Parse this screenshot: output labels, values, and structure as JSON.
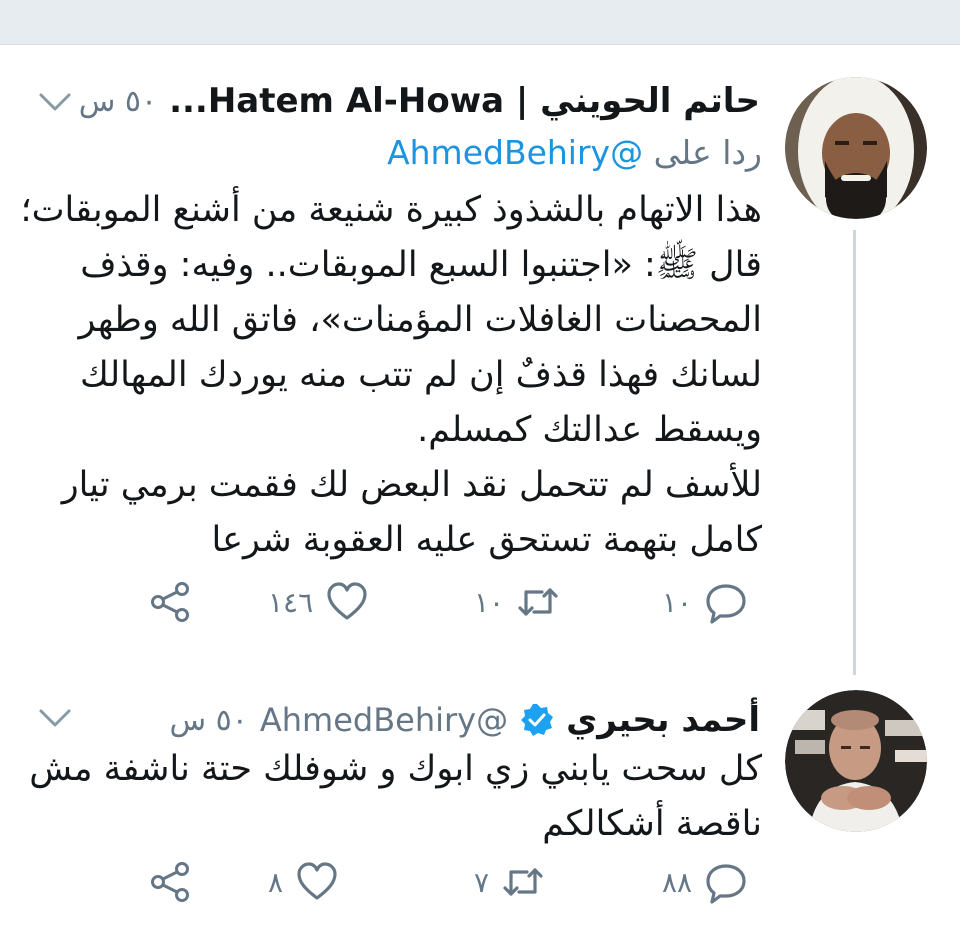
{
  "tweets": [
    {
      "display_name": "حاتم الحويني | Hatem Al-Howa...",
      "time": "٥٠ س",
      "replying_prefix": "ردا على",
      "replying_handle": "@AhmedBehiry",
      "lines": [
        "هذا الاتهام بالشذوذ كبيرة شنيعة من أشنع الموبقات؛",
        "قال ﷺ: «اجتنبوا السبع الموبقات.. وفيه: وقذف",
        "المحصنات الغافلات المؤمنات»، فاتق الله وطهر",
        "لسانك فهذا قذفٌ إن لم تتب منه يوردك المهالك",
        "ويسقط عدالتك كمسلم.",
        "للأسف لم تتحمل نقد البعض لك فقمت برمي تيار",
        "كامل بتهمة تستحق عليه العقوبة شرعا"
      ],
      "replies": "١٠",
      "retweets": "١٠",
      "likes": "١٤٦"
    },
    {
      "display_name": "أحمد بحيري",
      "handle": "@AhmedBehiry",
      "time": "٥٠ س",
      "lines": [
        "كل سحت يابني زي ابوك و شوفلك حتة ناشفة مش",
        "ناقصة أشكالكم"
      ],
      "replies": "٨٨",
      "retweets": "٧",
      "likes": "٨"
    }
  ],
  "colors": {
    "link": "#1b95e0",
    "secondary_text": "#657786",
    "top_bar": "#e6ecf0",
    "thread_line": "#ccd6dd"
  },
  "icons": [
    "reply-icon",
    "retweet-icon",
    "like-icon",
    "share-icon",
    "chevron-down-icon",
    "verified-badge-icon"
  ]
}
